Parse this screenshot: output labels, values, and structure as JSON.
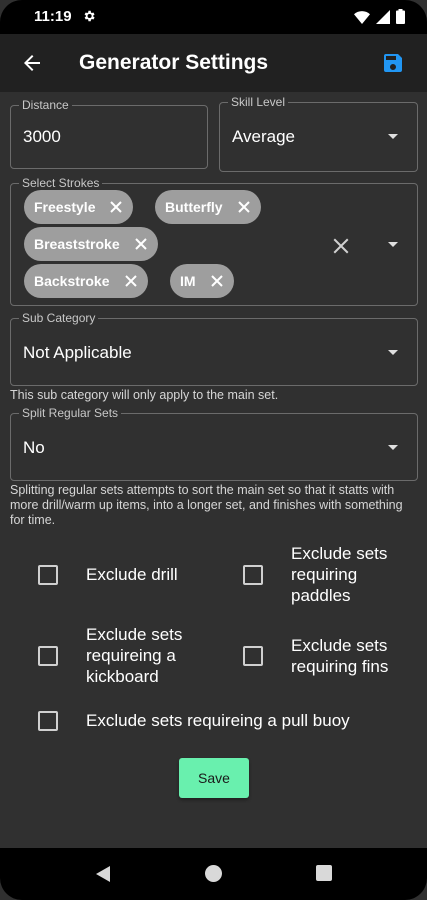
{
  "status_bar": {
    "time": "11:19",
    "icons": [
      "gear-icon",
      "wifi-icon",
      "signal-icon",
      "battery-icon"
    ]
  },
  "app_bar": {
    "title": "Generator Settings",
    "back_icon": "arrow-left-icon",
    "save_icon": "floppy-disk-icon",
    "accent_color": "#2196f3"
  },
  "distance": {
    "label": "Distance",
    "value": "3000"
  },
  "skill_level": {
    "label": "Skill Level",
    "value": "Average"
  },
  "strokes": {
    "label": "Select Strokes",
    "chips": [
      "Freestyle",
      "Butterfly",
      "Breaststroke",
      "Backstroke",
      "IM"
    ]
  },
  "sub_category": {
    "label": "Sub Category",
    "value": "Not Applicable",
    "helper": "This sub category will only apply to the main set."
  },
  "split_sets": {
    "label": "Split Regular Sets",
    "value": "No",
    "helper": "Splitting regular sets attempts to sort the main set so that it statts with more drill/warm up items, into a longer set, and finishes with something for time."
  },
  "options": {
    "exclude_drill": {
      "label": "Exclude drill",
      "checked": false
    },
    "exclude_paddles": {
      "label": "Exclude sets requiring paddles",
      "checked": false
    },
    "exclude_kickboard": {
      "label": "Exclude sets requireing a kickboard",
      "checked": false
    },
    "exclude_fins": {
      "label": "Exclude sets requiring fins",
      "checked": false
    },
    "exclude_pull_buoy": {
      "label": "Exclude sets requireing a pull buoy",
      "checked": false
    }
  },
  "save_button": {
    "label": "Save",
    "color": "#69f0ae"
  },
  "colors": {
    "background": "#303030",
    "app_bar": "#212121",
    "chip": "#9e9e9e"
  }
}
